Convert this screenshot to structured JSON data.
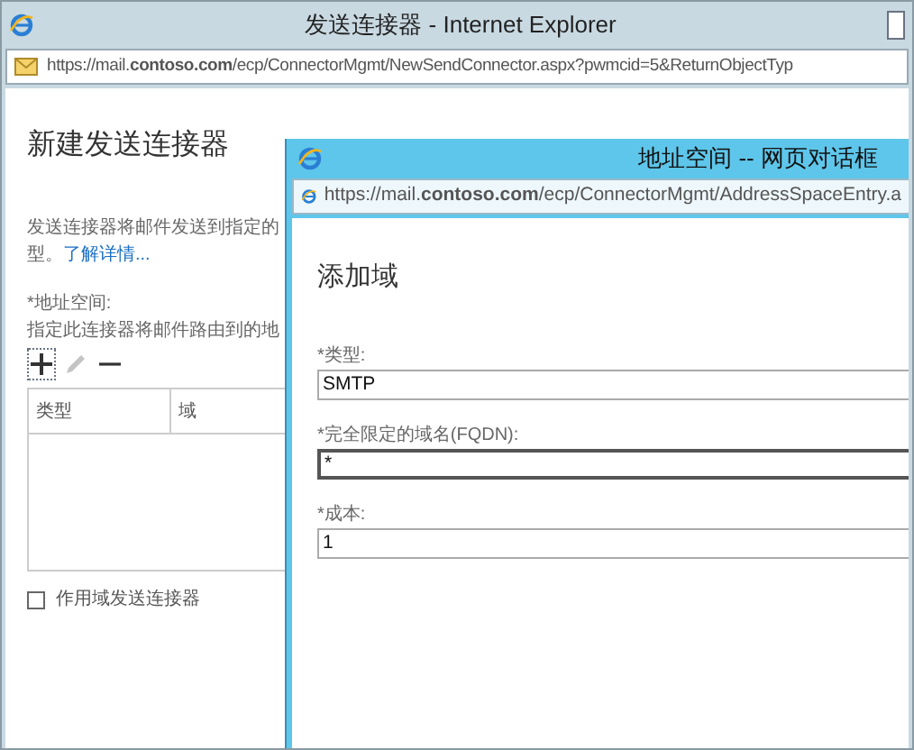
{
  "window": {
    "title": "发送连接器 - Internet Explorer",
    "url": "https://mail.**contoso.com**/ecp/ConnectorMgmt/NewSendConnector.aspx?pwmcid=5&ReturnObjectTyp"
  },
  "page": {
    "heading": "新建发送连接器",
    "description": "发送连接器将邮件发送到指定的",
    "description_line2": "型。",
    "learn_more": "了解详情...",
    "address_space_label": "*地址空间:",
    "address_space_hint": "指定此连接器将邮件路由到的地",
    "toolbar": [
      {
        "kind": "add",
        "disabled": false
      },
      {
        "kind": "edit",
        "disabled": true
      },
      {
        "kind": "remove",
        "disabled": false
      }
    ],
    "table": {
      "columns": [
        "类型",
        "域"
      ]
    },
    "scoped": {
      "label": "作用域发送连接器",
      "checked": false
    }
  },
  "dialog": {
    "title": "地址空间 -- 网页对话框",
    "url": "https://mail.**contoso.com**/ecp/ConnectorMgmt/AddressSpaceEntry.a",
    "heading": "添加域",
    "fields": [
      {
        "label": "*类型:",
        "value": "SMTP",
        "focused": false
      },
      {
        "label": "*完全限定的域名(FQDN):",
        "value": "*",
        "focused": true
      },
      {
        "label": "*成本:",
        "value": "1",
        "focused": false
      }
    ]
  }
}
